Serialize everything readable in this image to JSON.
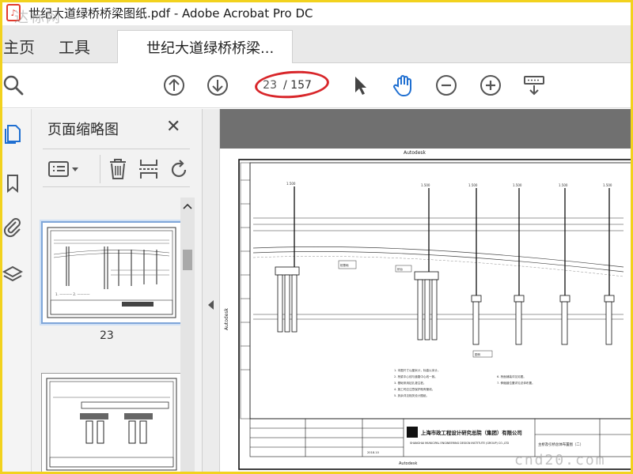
{
  "window": {
    "title": "世纪大道绿桥桥梁图纸.pdf - Adobe Acrobat Pro DC",
    "watermark_top": "达标网"
  },
  "tabs": {
    "home": "主页",
    "tools": "工具",
    "document": "世纪大道绿桥桥梁..."
  },
  "toolbar": {
    "current_page": "23",
    "page_total": "/ 157",
    "icons": [
      "search-icon",
      "page-up-icon",
      "page-down-icon",
      "select-cursor-icon",
      "hand-tool-icon",
      "zoom-out-icon",
      "zoom-in-icon",
      "keyboard-scroll-icon"
    ]
  },
  "rail": {
    "icons": [
      "page-thumbnails-icon",
      "bookmark-icon",
      "attachment-icon",
      "layers-icon"
    ]
  },
  "thumbnail_panel": {
    "title": "页面缩略图",
    "close": "✕",
    "tools": [
      "options-menu-icon",
      "delete-icon",
      "extract-pages-icon",
      "rotate-icon"
    ],
    "thumbnails": [
      {
        "label": "23",
        "selected": true
      },
      {
        "label": "",
        "selected": false
      }
    ]
  },
  "drawing": {
    "header_text": "Autodesk",
    "side_text": "Autodesk",
    "company": "上海市政工程设计研究总院（集团）有限公司",
    "company_en": "SHANGHAI MUNICIPAL ENGINEERING DESIGN INSTITUTE (GROUP) CO.,LTD",
    "sheet_title": "主桥及引桥总体布置图（二）",
    "date": "2018.10",
    "footer": "Autodesk"
  },
  "watermark_bottom": "cnd20.com"
}
